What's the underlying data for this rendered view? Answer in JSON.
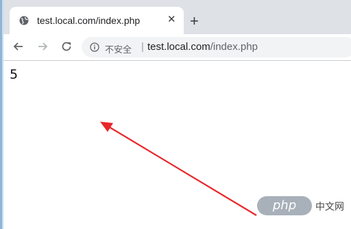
{
  "tab": {
    "title": "test.local.com/index.php",
    "close_glyph": "✕",
    "favicon": "globe-icon"
  },
  "new_tab_glyph": "+",
  "nav": {
    "back": "arrow-left-icon",
    "forward": "arrow-right-icon",
    "reload": "reload-icon"
  },
  "omnibox": {
    "security_icon": "info-icon",
    "security_text": "不安全",
    "separator": "|",
    "url_host": "test.local.com",
    "url_path": "/index.php"
  },
  "page": {
    "output": "5"
  },
  "annotation": {
    "arrow_color": "#e8262a"
  },
  "watermark": {
    "logo_text": "php",
    "site_text": "中文网"
  },
  "colors": {
    "tabstrip": "#dee1e6",
    "omnibox": "#f1f3f4"
  }
}
